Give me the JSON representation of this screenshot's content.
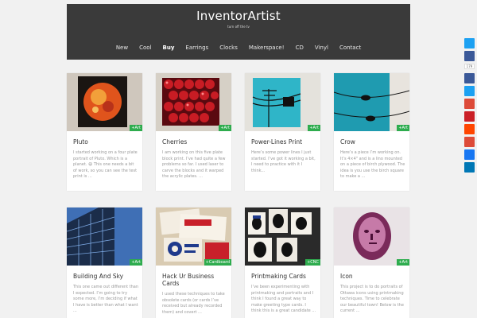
{
  "site": {
    "title": "InventorArtist",
    "tagline": "turn off the tv"
  },
  "nav": [
    "New",
    "Cool",
    "Buy",
    "Earrings",
    "Clocks",
    "Makerspace!",
    "CD",
    "Vinyl",
    "Contact"
  ],
  "posts": [
    {
      "title": "Pluto",
      "tag": "+Art",
      "excerpt": "I started working on a four plate portrait of Pluto. Which is a planet. 😃 This one needs a bit of work, so you can see the test print is ..."
    },
    {
      "title": "Cherries",
      "tag": "+Art",
      "excerpt": "I am working on this five plate block print. I’ve had quite a few problems so far. I used laser to carve the blocks and it warped the acrylic plates. ..."
    },
    {
      "title": "Power-Lines Print",
      "tag": "+Art",
      "excerpt": "Here’s some power lines I just started. I’ve got it working a bit, I need to practice with it I think..."
    },
    {
      "title": "Crow",
      "tag": "+Art",
      "excerpt": "Here’s a piece I’m working on. It’s 4×4\" and is a lino mounted on a piece of birch plywood. The idea is you use the birch square to make a ..."
    },
    {
      "title": "Building And Sky",
      "tag": "+Art",
      "excerpt": "This one came out different than I expected. I’m going to try some more, I’m deciding if what I have is better than what I want ..."
    },
    {
      "title": "Hack Ur Business Cards",
      "tag": "+Cardboard",
      "excerpt": "I used these techniques to take obsolete cards (or cards I’ve received but already recorded them) and covert ..."
    },
    {
      "title": "Printmaking Cards",
      "tag": "+CNC",
      "excerpt": "I’ve been experimenting with printmaking and portraits and I think I found a great way to make greeting type cards. I think this is a great candidate ..."
    },
    {
      "title": "Icon",
      "tag": "+Art",
      "excerpt": "This project is to do portraits of Ottawa icons using printmaking techniques. Time to celebrate our beautiful town! Below is the current ..."
    }
  ],
  "share": {
    "count": "179",
    "colors": [
      "#1da1f2",
      "#3b5998",
      "#3b5998",
      "#1da1f2",
      "#dd4b39",
      "#cb2027",
      "#ff4500",
      "#dd4b39",
      "#1877f2",
      "#0077b5"
    ]
  }
}
